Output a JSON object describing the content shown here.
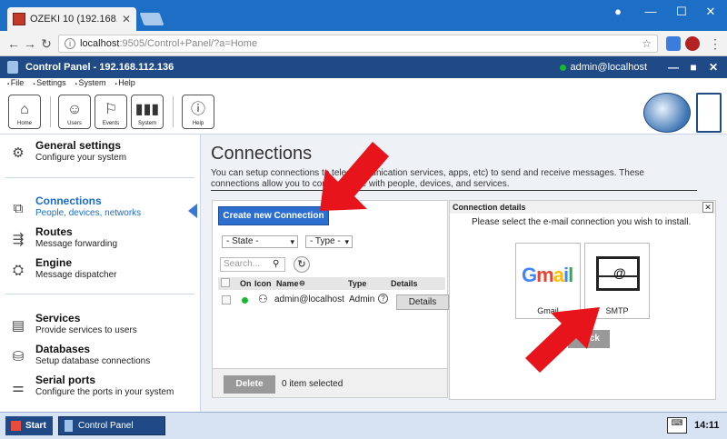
{
  "browser": {
    "tab_title": "OZEKI 10 (192.168.112.13",
    "url_host": "localhost",
    "url_rest": ":9505/Control+Panel/?a=Home"
  },
  "app": {
    "title": "Control Panel - 192.168.112.136",
    "user": "admin@localhost",
    "menu": [
      "File",
      "Settings",
      "System",
      "Help"
    ],
    "toolbar": [
      {
        "label": "Home",
        "icon": "home-icon"
      },
      {
        "label": "Users",
        "icon": "user-icon"
      },
      {
        "label": "Events",
        "icon": "flag-icon"
      },
      {
        "label": "System",
        "icon": "bars-icon"
      },
      {
        "label": "Help",
        "icon": "info-icon"
      }
    ]
  },
  "sidebar": {
    "items": [
      {
        "title": "General settings",
        "sub": "Configure your system",
        "icon": "gear-icon"
      },
      {
        "title": "Connections",
        "sub": "People, devices, networks",
        "icon": "connections-icon",
        "active": true
      },
      {
        "title": "Routes",
        "sub": "Message forwarding",
        "icon": "routes-icon"
      },
      {
        "title": "Engine",
        "sub": "Message dispatcher",
        "icon": "engine-icon"
      },
      {
        "title": "Services",
        "sub": "Provide services to users",
        "icon": "services-icon"
      },
      {
        "title": "Databases",
        "sub": "Setup database connections",
        "icon": "database-icon"
      },
      {
        "title": "Serial ports",
        "sub": "Configure the ports in your system",
        "icon": "serial-icon"
      }
    ]
  },
  "main": {
    "title": "Connections",
    "desc_line1": "You can setup connections to telecommunication services, apps, etc) to send and receive messages. These",
    "desc_line2": "connections allow you to communicate with people, devices, and services.",
    "create_button": "Create new Connection",
    "state_filter": "- State -",
    "type_filter": "- Type -",
    "search_placeholder": "Search...",
    "columns": {
      "on": "On",
      "icon": "Icon",
      "name": "Name",
      "type": "Type",
      "details": "Details"
    },
    "rows": [
      {
        "name": "admin@localhost",
        "type": "Admin",
        "details": "Details"
      }
    ],
    "delete_button": "Delete",
    "selected_text": "0 item selected"
  },
  "details_panel": {
    "header": "Connection details",
    "prompt": "Please select the e-mail connection you wish to install.",
    "tiles": [
      {
        "label": "Gmail",
        "logo": "Gmail"
      },
      {
        "label": "SMTP",
        "icon": "envelope-at-icon"
      }
    ],
    "back_button": "Back"
  },
  "taskbar": {
    "start": "Start",
    "app": "Control Panel",
    "clock": "14:11"
  },
  "colors": {
    "accent": "#2d6fcf",
    "titlebar": "#1f4a86",
    "arrow": "#e8141b",
    "status_on": "#1ab832"
  }
}
